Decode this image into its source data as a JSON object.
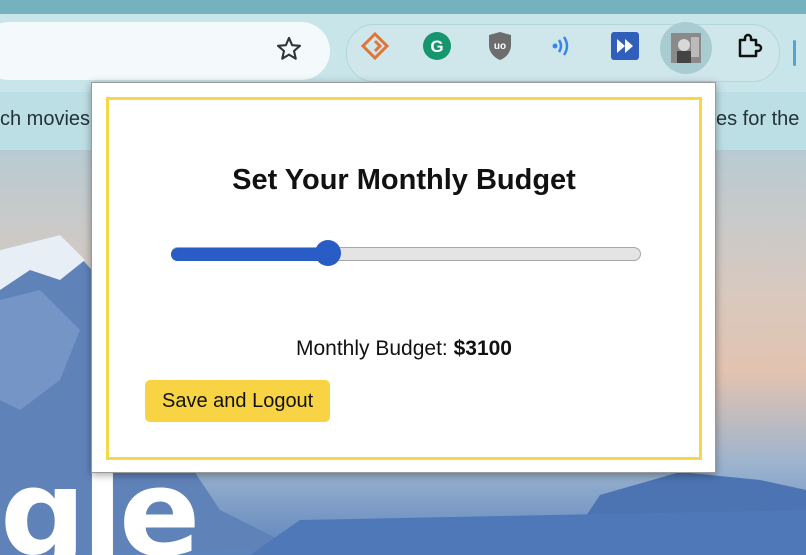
{
  "browser": {
    "bookmarks_left_text": "ch movies",
    "bookmarks_right_text": "es for the",
    "extensions": [
      {
        "name": "diamond-extension-icon",
        "color": "#e0753a"
      },
      {
        "name": "grammarly-icon",
        "color": "#15966d"
      },
      {
        "name": "ublock-icon",
        "color": "#6d6d6d"
      },
      {
        "name": "audio-waves-icon",
        "color": "#3a86e8"
      },
      {
        "name": "fast-forward-icon",
        "color": "#2f5fb8"
      },
      {
        "name": "profile-photo-icon",
        "color": "#555555"
      },
      {
        "name": "puzzle-extensions-icon",
        "color": "#111111"
      }
    ]
  },
  "wallpaper": {
    "text": "gle"
  },
  "popup": {
    "title": "Set Your Monthly Budget",
    "slider": {
      "value_fraction": 0.335
    },
    "budget_label": "Monthly Budget:",
    "budget_value": "$3100",
    "save_button": "Save and Logout"
  },
  "colors": {
    "accent": "#2a5cc5",
    "button": "#f8d444",
    "card_border": "#f5d849"
  }
}
